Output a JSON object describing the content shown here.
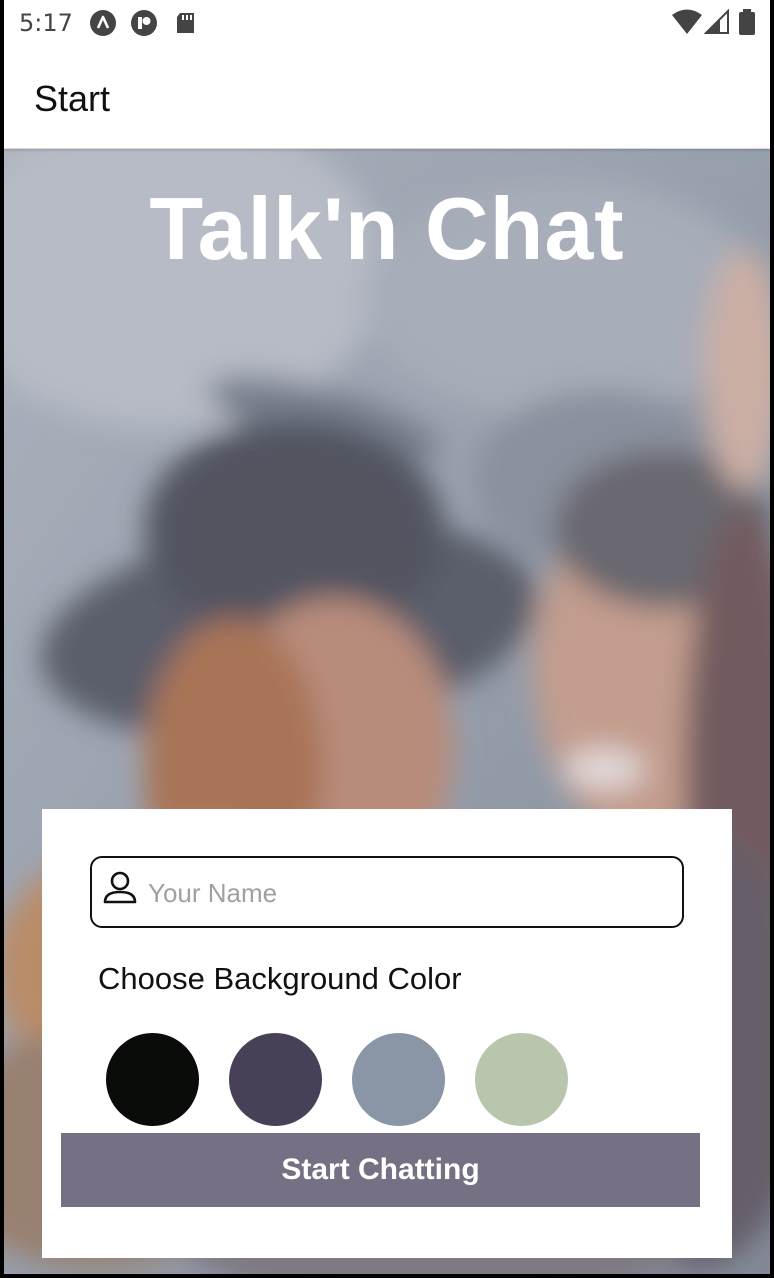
{
  "status_bar": {
    "time": "5:17",
    "left_icons": [
      "at-icon",
      "app-badge-icon",
      "sd-card-icon"
    ],
    "right_icons": [
      "wifi-icon",
      "signal-icon",
      "battery-icon"
    ]
  },
  "app_bar": {
    "title": "Start"
  },
  "hero": {
    "app_title": "Talk'n Chat"
  },
  "form": {
    "name_placeholder": "Your Name",
    "name_value": "",
    "choose_label": "Choose Background Color",
    "colors": [
      "#090C08",
      "#474056",
      "#8A95A5",
      "#B9C6AE"
    ],
    "start_label": "Start Chatting",
    "start_button_color": "#757083"
  }
}
